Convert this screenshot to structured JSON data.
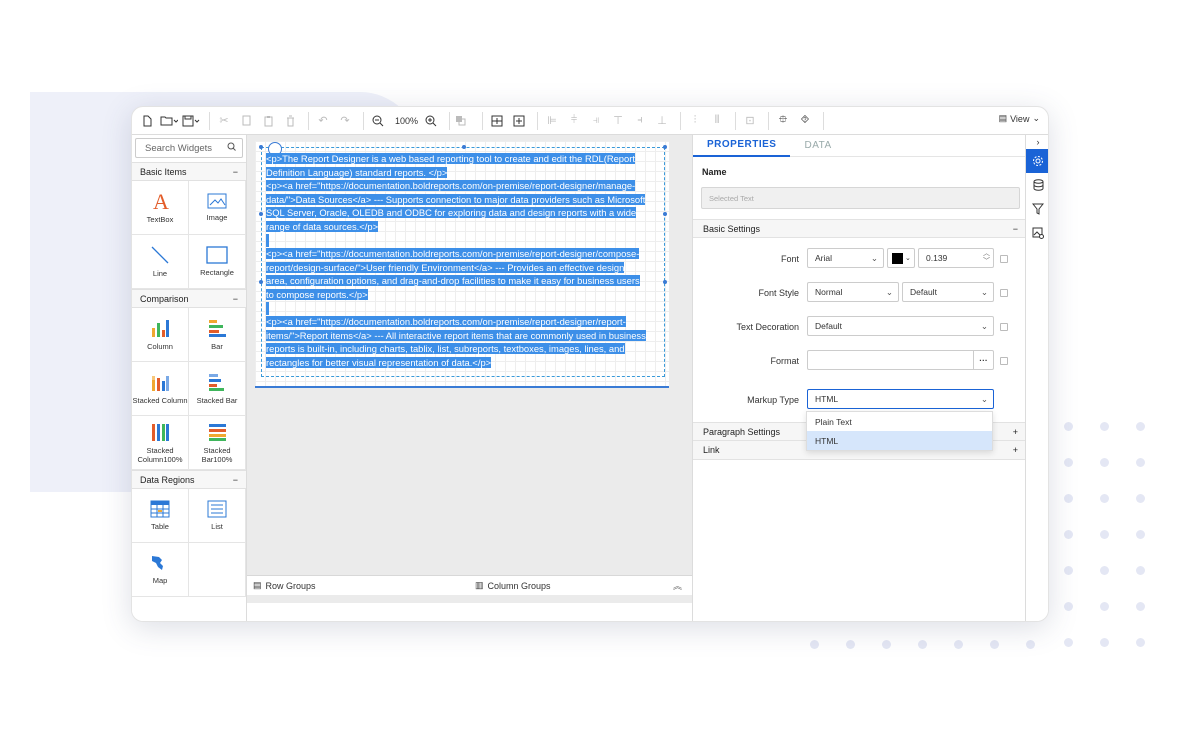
{
  "toolbar": {
    "zoom": "100%",
    "view_label": "View"
  },
  "left_panel": {
    "search_placeholder": "Search Widgets",
    "categories": [
      {
        "name": "Basic Items",
        "items": [
          "TextBox",
          "Image",
          "Line",
          "Rectangle"
        ]
      },
      {
        "name": "Comparison",
        "items": [
          "Column",
          "Bar",
          "Stacked Column",
          "Stacked Bar",
          "Stacked Column100%",
          "Stacked Bar100%"
        ]
      },
      {
        "name": "Data Regions",
        "items": [
          "Table",
          "List",
          "Map"
        ]
      }
    ],
    "collapse_symbol": "−"
  },
  "canvas": {
    "text_lines": [
      "<p>The Report Designer is a web based reporting tool to create and edit the RDL(Report",
      "Definition Language) standard reports. </p>",
      "<p><a href=\"https://documentation.boldreports.com/on-premise/report-designer/manage-",
      "data/\">Data Sources</a> --- Supports connection to major data providers such as Microsoft",
      "SQL Server, Oracle, OLEDB and ODBC for exploring data and design reports with a wide",
      "range of data sources.</p>",
      "",
      "<p><a href=\"https://documentation.boldreports.com/on-premise/report-designer/compose-",
      "report/design-surface/\">User friendly Environment</a> --- Provides an effective design",
      "area, configuration options, and drag-and-drop facilities to make it easy for business users",
      "to compose reports.</p>",
      "",
      "<p><a href=\"https://documentation.boldreports.com/on-premise/report-designer/report-",
      "items/\">Report items</a> --- All interactive report items that are commonly used in business",
      "reports is built-in, including charts, tablix, list, subreports, textboxes, images, lines, and",
      "rectangles for better visual representation of data.</p>"
    ],
    "row_groups": "Row Groups",
    "column_groups": "Column Groups"
  },
  "properties": {
    "tabs": [
      "PROPERTIES",
      "DATA"
    ],
    "name_label": "Name",
    "name_placeholder": "Selected Text",
    "basic_settings": "Basic Settings",
    "font_label": "Font",
    "font_value": "Arial",
    "font_size": "0.139",
    "font_color": "#000000",
    "font_style_label": "Font Style",
    "font_style_value": "Normal",
    "font_weight_value": "Default",
    "text_decoration_label": "Text Decoration",
    "text_decoration_value": "Default",
    "format_label": "Format",
    "format_button": "···",
    "markup_type_label": "Markup Type",
    "markup_type_value": "HTML",
    "markup_options": [
      "Plain Text",
      "HTML"
    ],
    "paragraph_settings": "Paragraph Settings",
    "link": "Link",
    "expand_symbol": "+",
    "collapse_symbol": "−"
  },
  "colors": {
    "accent": "#1a63d6",
    "selection": "#3d8fe8"
  }
}
